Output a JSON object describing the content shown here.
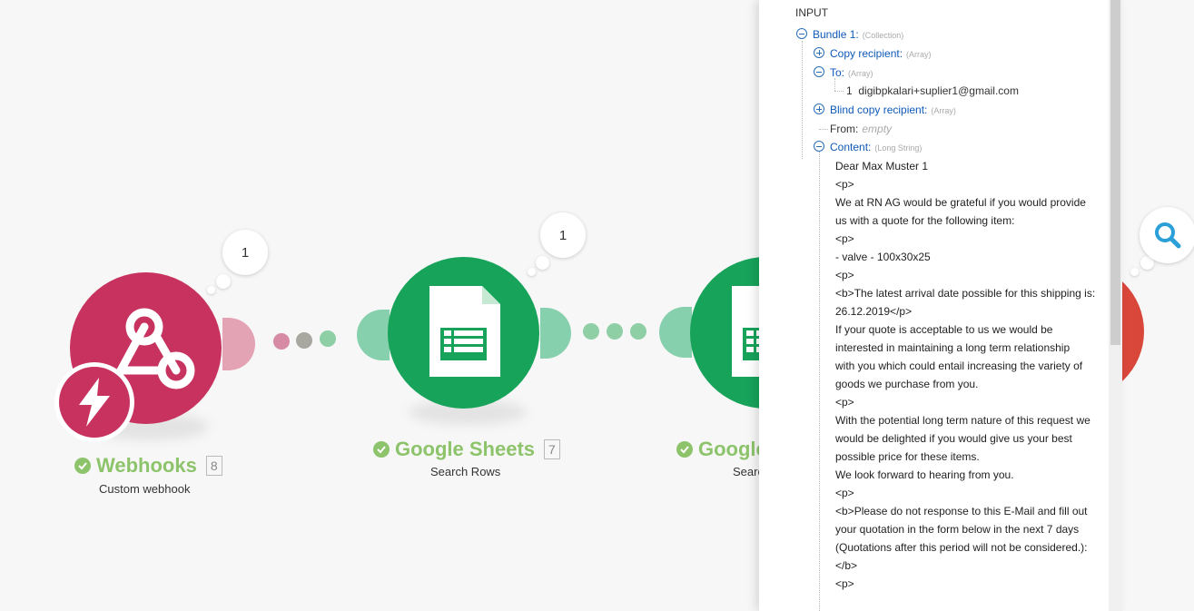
{
  "modules": [
    {
      "name": "Webhooks",
      "count": "8",
      "subtitle": "Custom webhook",
      "bubble": "1"
    },
    {
      "name": "Google Sheets",
      "count": "7",
      "subtitle": "Search Rows",
      "bubble": "1"
    },
    {
      "name": "Google",
      "subtitle": "Searc"
    }
  ],
  "colors": {
    "webhooks": "#c7325f",
    "sheets": "#17a35a",
    "green_label": "#8dc46b",
    "key_blue": "#0f5ab8",
    "search_blue": "#2a9fd8",
    "red_module": "#d9473b"
  },
  "panel": {
    "section": "INPUT",
    "bundle_label": "Bundle 1:",
    "bundle_type": "(Collection)",
    "copy_label": "Copy recipient:",
    "copy_type": "(Array)",
    "to_label": "To:",
    "to_type": "(Array)",
    "to_index": "1",
    "to_value": "digibpkalari+suplier1@gmail.com",
    "bcc_label": "Blind copy recipient:",
    "bcc_type": "(Array)",
    "from_label": "From:",
    "from_value": "empty",
    "content_label": "Content:",
    "content_type": "(Long String)",
    "content_lines": [
      "Dear Max Muster 1",
      "<p>",
      "We at RN AG would be grateful if you would provide",
      "us with a quote for the following item:",
      "<p>",
      "- valve - 100x30x25",
      "<p>",
      "<b>The latest arrival date possible for this shipping is:",
      "26.12.2019</p>",
      "If your quote is acceptable to us we would be",
      "interested in maintaining a long term relationship",
      "with you which could entail increasing the variety of",
      "goods we purchase from you.",
      "<p>",
      "With the potential long term nature of this request we",
      "would be delighted if you would give us your best",
      "possible price for these items.",
      "We look forward to hearing from you.",
      "<p>",
      "<b>Please do not response to this E-Mail and fill out",
      "your quotation in the form below in the next 7 days",
      "(Quotations after this period will not be considered.):",
      "</b>",
      "<p>"
    ]
  }
}
